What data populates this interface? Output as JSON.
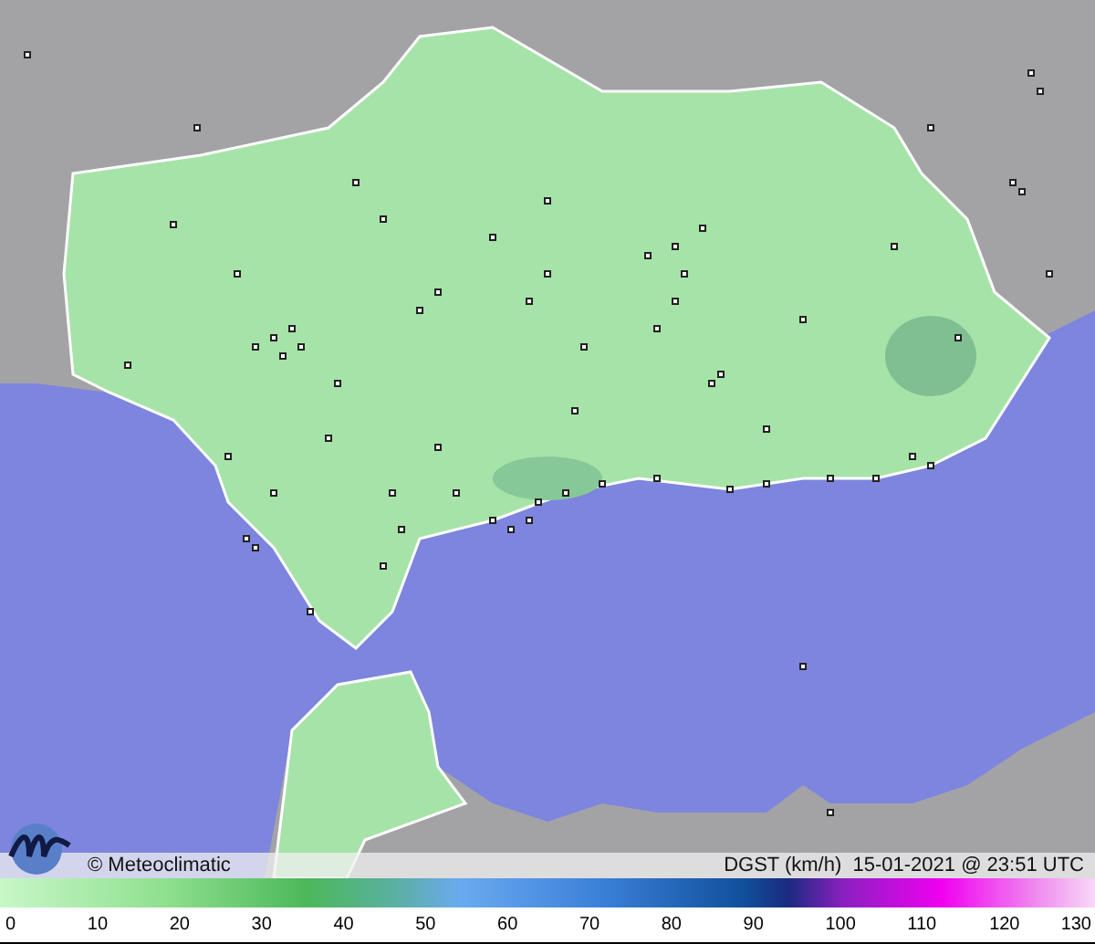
{
  "map": {
    "credit": "© Meteoclimatic",
    "caption": "DGST (km/h)  15-01-2021 @ 23:51 UTC"
  },
  "scale": {
    "ticks": [
      "0",
      "10",
      "20",
      "30",
      "40",
      "50",
      "60",
      "70",
      "80",
      "90",
      "100",
      "110",
      "120",
      "130"
    ]
  }
}
